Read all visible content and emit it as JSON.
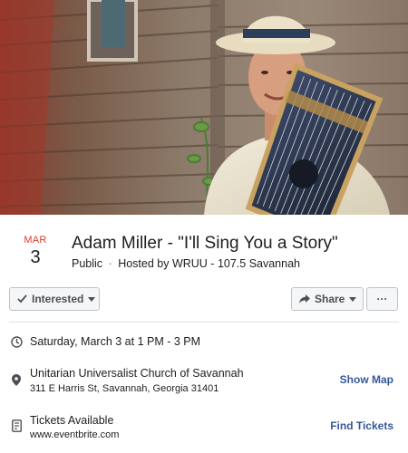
{
  "event": {
    "month": "MAR",
    "day": "3",
    "title": "Adam Miller - \"I'll Sing You a Story\"",
    "privacy": "Public",
    "separator": "·",
    "host_prefix": "Hosted by",
    "host_name": "WRUU - 107.5 Savannah"
  },
  "actions": {
    "interested_label": "Interested",
    "share_label": "Share",
    "more_label": "···"
  },
  "details": {
    "time": "Saturday, March 3 at 1 PM - 3 PM",
    "location_name": "Unitarian Universalist Church of Savannah",
    "location_address": "311 E Harris St, Savannah, Georgia 31401",
    "location_action": "Show Map",
    "tickets_title": "Tickets Available",
    "tickets_url": "www.eventbrite.com",
    "tickets_action": "Find Tickets"
  },
  "colors": {
    "month_red": "#e0392b",
    "link_blue": "#365899",
    "button_bg": "#f5f6f7",
    "border": "#bec3c9"
  },
  "icons": {
    "interested": "check-icon",
    "share": "share-arrow-icon",
    "time": "clock-icon",
    "location": "map-pin-icon",
    "tickets": "ticket-icon"
  }
}
